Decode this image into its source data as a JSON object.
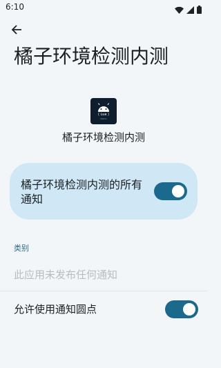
{
  "status_bar": {
    "time": "6:10",
    "icons": [
      "wifi-icon",
      "signal-icon",
      "battery-icon"
    ]
  },
  "header": {
    "back_icon": "arrow-back-icon",
    "title": "橘子环境检测内测"
  },
  "app": {
    "icon_text": "( Lua )",
    "icon_subtext": "Demo",
    "name": "橘子环境检测内测"
  },
  "all_notifications": {
    "label": "橘子环境检测内测的所有通知",
    "enabled": true
  },
  "categories": {
    "header": "类别",
    "empty_text": "此应用未发布任何通知"
  },
  "notification_dots": {
    "label": "允许使用通知圆点",
    "enabled": true
  },
  "colors": {
    "background": "#f3f6f8",
    "card": "#d0e8f6",
    "accent": "#1b6a8d",
    "section_header": "#2c6a8a"
  }
}
